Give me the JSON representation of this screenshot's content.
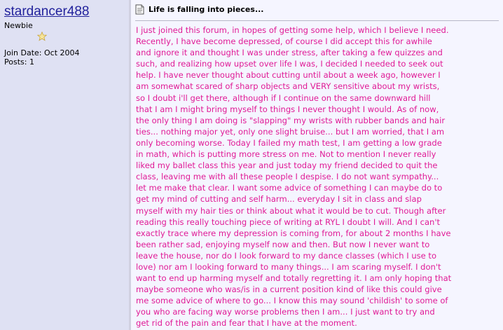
{
  "user": {
    "username": "stardancer488",
    "title": "Newbie",
    "join_date": "Join Date: Oct 2004",
    "posts": "Posts: 1",
    "rank_icon": "star-icon"
  },
  "post": {
    "icon": "document-icon",
    "title": "Life is falling into pieces...",
    "message_lines": [
      "I just joined this forum, in hopes of getting some help, which I believe I need.",
      "Recently, I have become depressed, of course I did accept this for awhile",
      "and ignore it and thought I was under stress, after taking a few quizzes and",
      "such, and realizing how upset over life I was, I decided I needed to seek out",
      "help. I have never thought about cutting until about a week ago, however I",
      "am somewhat scared of sharp objects and VERY sensitive about my wrists,",
      "so I doubt i'll get there, although if I continue on the same downward hill",
      "that I am I might bring myself to things I never thought I would. As of now,",
      "the only thing I am doing is \"slapping\" my wrists with rubber bands and hair",
      "ties... nothing major yet, only one slight bruise... but I am worried, that I am",
      "only becoming worse. Today I failed my math test, I am getting a low grade",
      "in math, which is putting more stress on me. Not to mention I never really",
      "liked my ballet class this year and just today my friend decided to quit the",
      "class, leaving me with all these people I despise. I do not want sympathy...",
      "let me make that clear. I want some advice of something I can maybe do to",
      "get my mind of cutting and self harm... everyday I sit in class and slap",
      "myself with my hair ties or think about what it would be to cut. Though after",
      "reading this really touching piece of writing at RYL I doubt I will. And I can't",
      "exactly trace where my depression is coming from, for about 2 months I have",
      "been rather sad, enjoying myself now and then. But now I never want to",
      "leave the house, nor do I look forward to my dance classes (which I use to",
      "love) nor am I looking forward to many things... I am scaring myself. I don't",
      "want to end up harming myself and totally regretting it. I am only hoping that",
      "maybe someone who was/is in a current position kind of like this could give",
      "me some advice of where to go... I know this may sound 'childish' to some of",
      "you who are facing way worse problems then I am... I just want to try and",
      "get rid of the pain and fear that I have at the moment."
    ]
  },
  "colors": {
    "sidebar_bg": "#dfe1f3",
    "content_bg": "#f5f5ff",
    "separator": "#d1d1e1",
    "username": "#22229c",
    "message_text": "#e01a96"
  }
}
